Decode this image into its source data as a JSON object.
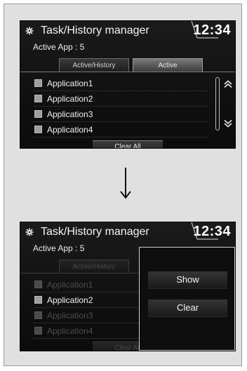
{
  "screen_top": {
    "title": "Task/History manager",
    "clock": "12:34",
    "active_count": "Active App : 5",
    "tabs": [
      "Active/History",
      "Active"
    ],
    "items": [
      "Application1",
      "Application2",
      "Application3",
      "Application4"
    ],
    "clear_all": "Clear All"
  },
  "screen_bottom": {
    "title": "Task/History manager",
    "clock": "12:34",
    "active_count": "Active App : 5",
    "tabs": [
      "Active/History"
    ],
    "items": [
      "Application1",
      "Application2",
      "Application3",
      "Application4"
    ],
    "clear_all": "Clear All",
    "popup": {
      "show": "Show",
      "clear": "Clear"
    }
  },
  "icons": {
    "header": "gear-icon",
    "scroll_up": "chevron-up-icon",
    "scroll_down": "chevron-down-icon",
    "transition": "down-arrow-icon"
  }
}
